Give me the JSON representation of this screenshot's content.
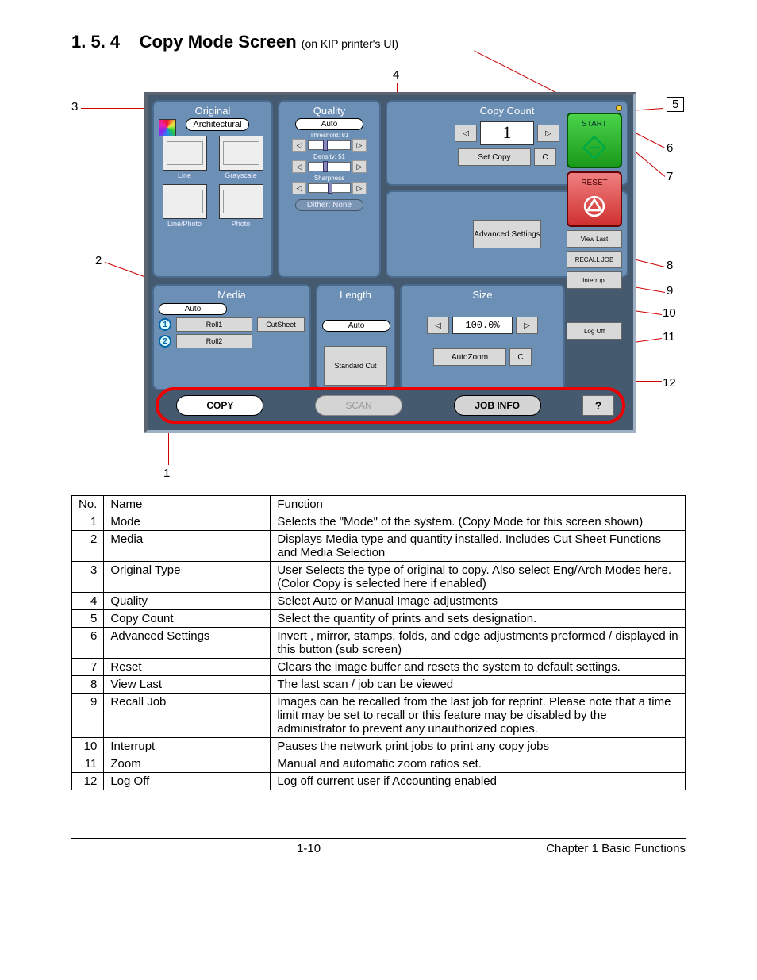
{
  "heading": {
    "num": "1. 5. 4",
    "title": "Copy Mode Screen",
    "suffix": "(on KIP printer's UI)"
  },
  "callouts": [
    "1",
    "2",
    "3",
    "4",
    "5",
    "6",
    "7",
    "8",
    "9",
    "10",
    "11",
    "12"
  ],
  "ui": {
    "original": {
      "title": "Original",
      "architectural": "Architectural",
      "thumbs": [
        "Line",
        "Grayscale",
        "Line/Photo",
        "Photo"
      ]
    },
    "quality": {
      "title": "Quality",
      "auto": "Auto",
      "threshold": "Threshold: 81",
      "density": "Density: 51",
      "sharpness": "Sharpness",
      "dither": "Dither: None"
    },
    "copy": {
      "title": "Copy Count",
      "value": "1",
      "setcopy": "Set Copy",
      "clear": "C"
    },
    "advanced": "Advanced Settings",
    "actions": {
      "start": "START",
      "reset": "RESET",
      "viewlast": "View Last",
      "recall": "RECALL JOB",
      "interrupt": "Interrupt",
      "logoff": "Log Off"
    },
    "media": {
      "title": "Media",
      "auto": "Auto",
      "roll1": "Roll1",
      "roll2": "Roll2",
      "cutsheet": "CutSheet"
    },
    "length": {
      "title": "Length",
      "auto": "Auto",
      "std": "Standard Cut"
    },
    "size": {
      "title": "Size",
      "value": "100.0%",
      "autozoom": "AutoZoom",
      "clear": "C"
    },
    "modes": {
      "copy": "COPY",
      "scan": "SCAN",
      "info": "JOB INFO",
      "help": "?"
    }
  },
  "table": {
    "headers": [
      "No.",
      "Name",
      "Function"
    ],
    "rows": [
      {
        "no": "1",
        "name": "Mode",
        "fn": "Selects the \"Mode\" of the system. (Copy Mode for this screen shown)"
      },
      {
        "no": "2",
        "name": "Media",
        "fn": "Displays Media type and quantity installed. Includes Cut Sheet Functions and Media Selection"
      },
      {
        "no": "3",
        "name": "Original Type",
        "fn": "User Selects the type of original to copy. Also select Eng/Arch Modes here. (Color Copy is selected here if enabled)"
      },
      {
        "no": "4",
        "name": "Quality",
        "fn": "Select Auto or Manual Image adjustments"
      },
      {
        "no": "5",
        "name": "Copy Count",
        "fn": "Select the quantity of prints and sets designation."
      },
      {
        "no": "6",
        "name": "Advanced Settings",
        "fn": "Invert , mirror, stamps, folds, and edge adjustments preformed / displayed in this button (sub screen)"
      },
      {
        "no": "7",
        "name": "Reset",
        "fn": "Clears the image buffer and resets the system to default settings."
      },
      {
        "no": "8",
        "name": "View Last",
        "fn": "The last scan / job can be viewed"
      },
      {
        "no": "9",
        "name": "Recall Job",
        "fn": "Images can be recalled from the last job for reprint. Please note that a time limit may be set to recall or this feature may be disabled by the administrator to prevent any unauthorized copies."
      },
      {
        "no": "10",
        "name": "Interrupt",
        "fn": "Pauses the network print jobs to print any copy jobs"
      },
      {
        "no": "11",
        "name": "Zoom",
        "fn": "Manual and automatic zoom ratios set."
      },
      {
        "no": "12",
        "name": "Log Off",
        "fn": "Log off current user if Accounting enabled"
      }
    ]
  },
  "footer": {
    "page": "1-10",
    "chapter": "Chapter 1   Basic Functions"
  }
}
